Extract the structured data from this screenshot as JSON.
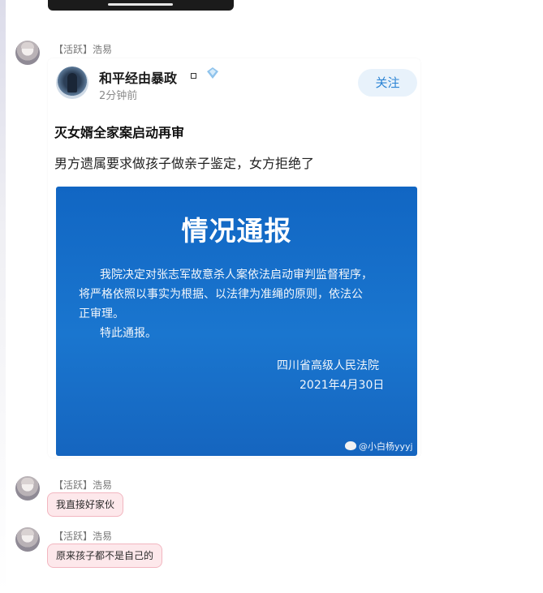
{
  "messages": [
    {
      "sender": "【活跃】浩易"
    },
    {
      "sender": "【活跃】浩易",
      "text": "我直接好家伙"
    },
    {
      "sender": "【活跃】浩易",
      "text": "原来孩子都不是自己的"
    }
  ],
  "post": {
    "author": "和平经由暴政",
    "time": "2分钟前",
    "follow_label": "关注",
    "title": "灭女婿全家案启动再审",
    "body": "男方遗属要求做孩子做亲子鉴定，女方拒绝了"
  },
  "notice": {
    "title": "情况通报",
    "line1": "我院决定对张志军故意杀人案依法启动审判监督程序，",
    "line2": "将严格依照以事实为根据、以法律为准绳的原则，依法公",
    "line3": "正审理。",
    "line4": "特此通报。",
    "org": "四川省高级人民法院",
    "date": "2021年4月30日",
    "watermark": "@小白杨yyyj"
  },
  "colors": {
    "bubble_bg": "#fde8eb",
    "bubble_border": "#f2b6c0",
    "follow_text": "#2b84d4",
    "notice_bg": "#1a76cf"
  }
}
